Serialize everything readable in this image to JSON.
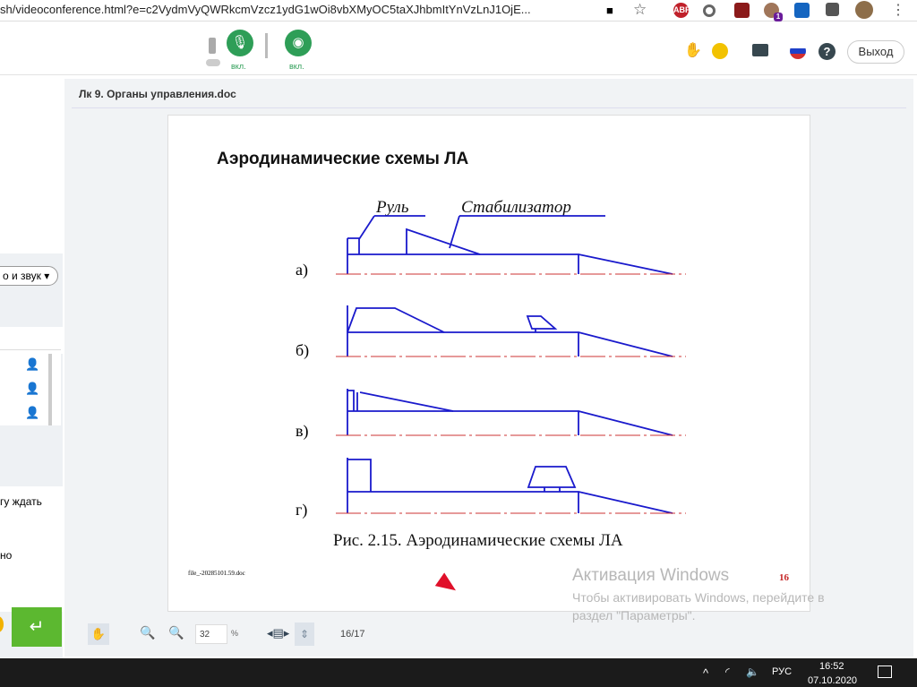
{
  "browser": {
    "url": "sh/videoconference.html?e=c2VydmVyQWRkcmVzcz1ydG1wOi8vbXMyOC5taXJhbmItYnVzLnJ1OjE...",
    "extensions": [
      "camera-icon",
      "star-icon",
      "adblock-icon",
      "opera-icon",
      "pdf-icon",
      "monkey-icon",
      "translate-icon",
      "puzzle-icon",
      "profile-avatar",
      "menu-icon"
    ],
    "ext_badge": "1",
    "abp": "ABP"
  },
  "conference": {
    "mic_label": "вкл.",
    "cam_label": "вкл.",
    "exit_label": "Выход"
  },
  "left": {
    "dropdown": "о и звук",
    "chat_text_1": "гу ждать",
    "chat_text_2": "но",
    "send_icon": "enter-icon"
  },
  "document": {
    "title": "Лк 9. Органы управления.doc",
    "heading": "Аэродинамические схемы ЛА",
    "label_rudder": "Руль",
    "label_stabilizer": "Стабилизатор",
    "variants": [
      "а)",
      "б)",
      "в)",
      "г)"
    ],
    "caption": "Рис. 2.15. Аэродинамические схемы ЛА",
    "footer_file": "file_-20285101.59.doc",
    "page_number": "16",
    "colors": {
      "lines": "#1a1acc",
      "axis": "#cc3333"
    }
  },
  "toolbar": {
    "zoom": "32",
    "percent": "%",
    "page": "16/17"
  },
  "watermark": {
    "title": "Активация Windows",
    "line1": "Чтобы активировать Windows, перейдите в",
    "line2": "раздел \"Параметры\"."
  },
  "taskbar": {
    "lang": "РУС",
    "time": "16:52",
    "date": "07.10.2020"
  }
}
